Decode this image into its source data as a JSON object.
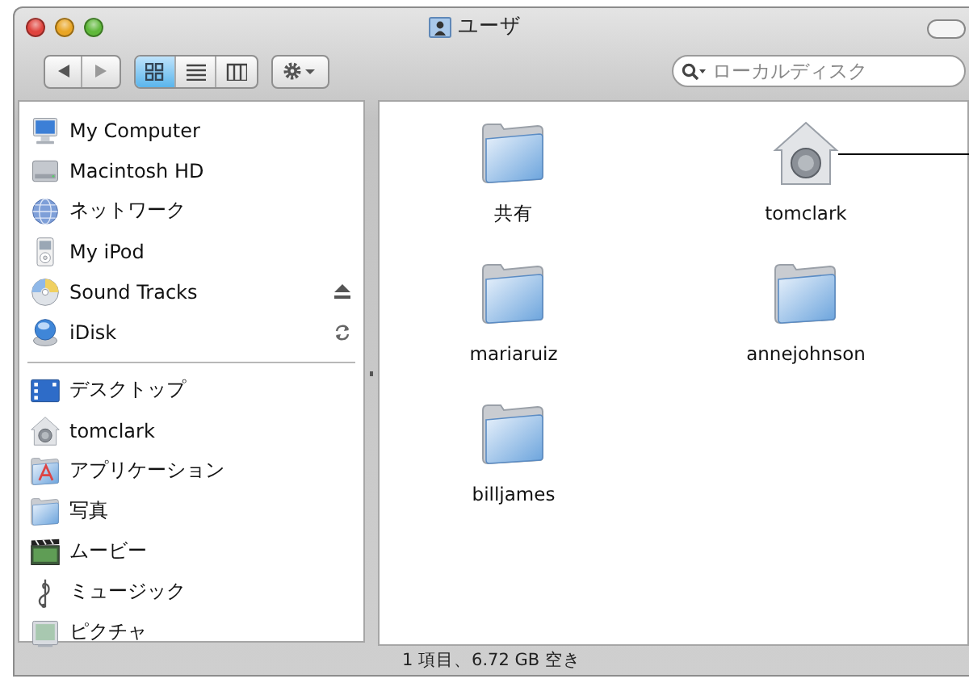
{
  "window": {
    "title": "ユーザ",
    "buttons": [
      {
        "color": "#e0443e"
      },
      {
        "color": "#e9a524"
      },
      {
        "color": "#5fb83a"
      }
    ]
  },
  "toolbar": {
    "view_buttons": [
      {
        "kind": "icons",
        "selected": true
      },
      {
        "kind": "list",
        "selected": false
      },
      {
        "kind": "columns",
        "selected": false
      }
    ],
    "search": {
      "placeholder": "ローカルディスク"
    }
  },
  "sidebar": {
    "sections": [
      {
        "items": [
          {
            "label": "My Computer",
            "kind": "computer"
          },
          {
            "label": "Macintosh HD",
            "kind": "disk"
          },
          {
            "label": "ネットワーク",
            "kind": "network"
          },
          {
            "label": "My iPod",
            "kind": "ipod"
          },
          {
            "label": "Sound Tracks",
            "kind": "cd",
            "accessory": {
              "kind": "eject"
            }
          },
          {
            "label": "iDisk",
            "kind": "idisk",
            "accessory": {
              "kind": "sync"
            }
          }
        ]
      },
      {
        "items": [
          {
            "label": "デスクトップ",
            "kind": "desktop"
          },
          {
            "label": "tomclark",
            "kind": "home"
          },
          {
            "label": "アプリケーション",
            "kind": "applications"
          },
          {
            "label": "写真",
            "kind": "folder"
          },
          {
            "label": "ムービー",
            "kind": "movies"
          },
          {
            "label": "ミュージック",
            "kind": "music"
          },
          {
            "label": "ピクチャ",
            "kind": "pictures"
          }
        ]
      }
    ]
  },
  "content": {
    "items": [
      {
        "label": "共有",
        "kind": "folder"
      },
      {
        "label": "tomclark",
        "kind": "home",
        "callout": true
      },
      {
        "label": "mariaruiz",
        "kind": "folder"
      },
      {
        "label": "annejohnson",
        "kind": "folder"
      },
      {
        "label": "billjames",
        "kind": "folder"
      }
    ]
  },
  "status_bar": "1 項目、6.72 GB 空き"
}
